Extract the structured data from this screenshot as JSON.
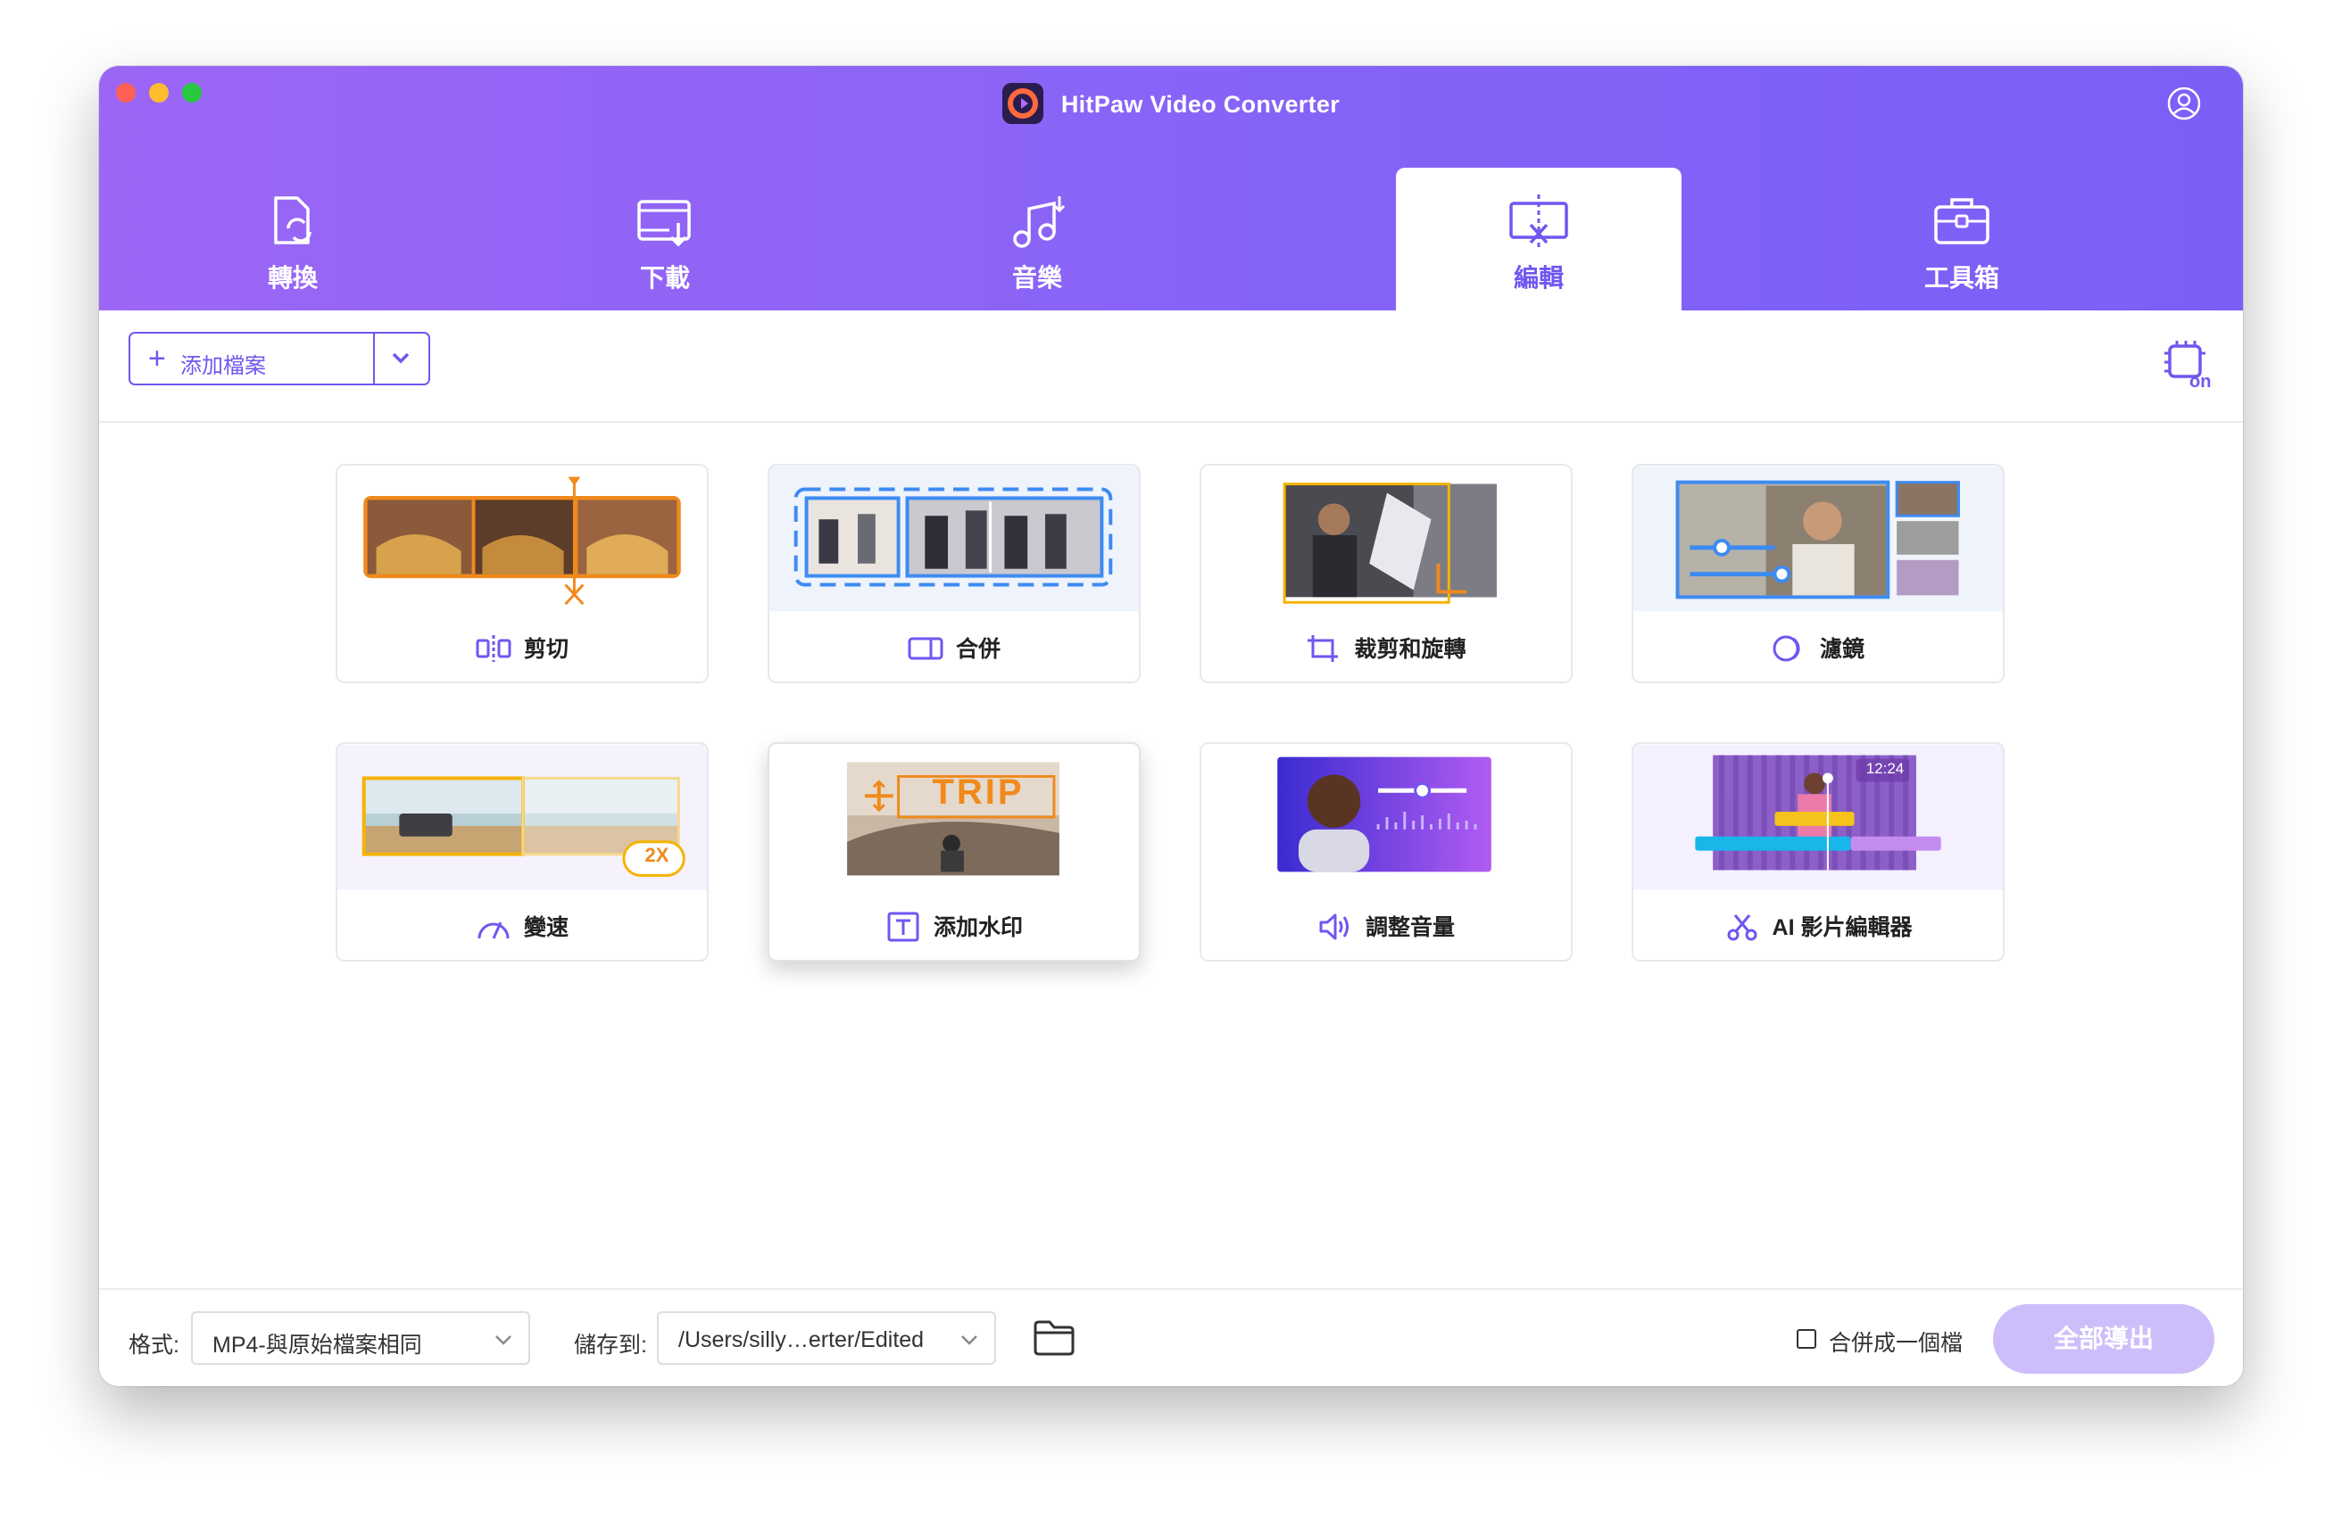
{
  "app": {
    "title": "HitPaw Video Converter"
  },
  "tabs": [
    {
      "label": "轉換",
      "icon": "convert-icon"
    },
    {
      "label": "下載",
      "icon": "download-icon"
    },
    {
      "label": "音樂",
      "icon": "music-icon"
    },
    {
      "label": "編輯",
      "icon": "edit-icon",
      "active": true
    },
    {
      "label": "工具箱",
      "icon": "toolbox-icon"
    }
  ],
  "toolbar": {
    "add_label": "添加檔案"
  },
  "tools": [
    {
      "label": "剪切",
      "icon": "cut-icon"
    },
    {
      "label": "合併",
      "icon": "merge-icon"
    },
    {
      "label": "裁剪和旋轉",
      "icon": "crop-rotate-icon"
    },
    {
      "label": "濾鏡",
      "icon": "filter-icon"
    },
    {
      "label": "變速",
      "icon": "speed-icon",
      "badge": "2X"
    },
    {
      "label": "添加水印",
      "icon": "watermark-icon",
      "watermark_text": "TRIP",
      "selected": true
    },
    {
      "label": "調整音量",
      "icon": "volume-icon"
    },
    {
      "label": "AI 影片編輯器",
      "icon": "ai-editor-icon",
      "time": "12:24"
    }
  ],
  "footer": {
    "format_label": "格式:",
    "format_value": "MP4-與原始檔案相同",
    "save_label": "儲存到:",
    "save_value": "/Users/silly…erter/Edited",
    "merge_label": "合併成一個檔",
    "merge_checked": false,
    "export_label": "全部導出"
  },
  "colors": {
    "accent": "#6f57f0",
    "header_start": "#9c66f5",
    "header_end": "#7b5ff7",
    "export_disabled": "#cdbefb"
  }
}
